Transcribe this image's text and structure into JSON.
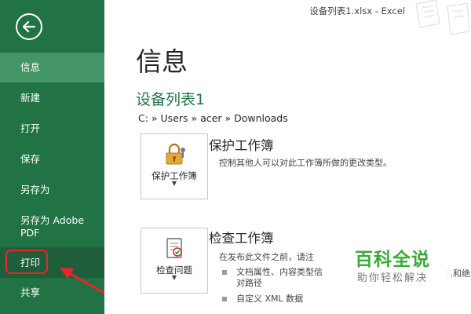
{
  "window": {
    "title": "设备列表1.xlsx - Excel"
  },
  "sidebar": {
    "items": [
      {
        "label": "信息"
      },
      {
        "label": "新建"
      },
      {
        "label": "打开"
      },
      {
        "label": "保存"
      },
      {
        "label": "另存为"
      },
      {
        "label": "另存为 Adobe PDF"
      },
      {
        "label": "打印"
      },
      {
        "label": "共享"
      }
    ]
  },
  "main": {
    "page_title": "信息",
    "file_name": "设备列表1",
    "path": "C: » Users » acer » Downloads",
    "protect": {
      "button_label": "保护工作簿",
      "heading": "保护工作簿",
      "description": "控制其他人可以对此工作簿所做的更改类型。"
    },
    "inspect": {
      "button_label": "检查问题",
      "heading": "检查工作簿",
      "description": "在发布此文件之前，请注",
      "bullets": [
        "文档属性、内容类型信",
        "对路径",
        "自定义 XML 数据"
      ],
      "overflow_text": "名和绝"
    }
  },
  "watermark": {
    "main": "百科全说",
    "sub": "助你轻松解决"
  },
  "colors": {
    "sidebar_bg": "#217346",
    "sidebar_active": "#439467",
    "accent_green": "#217346",
    "highlight_red": "#e8262c"
  },
  "icons": {
    "back": "back-arrow-icon",
    "protect": "lock-key-icon",
    "inspect": "inspect-document-icon"
  }
}
